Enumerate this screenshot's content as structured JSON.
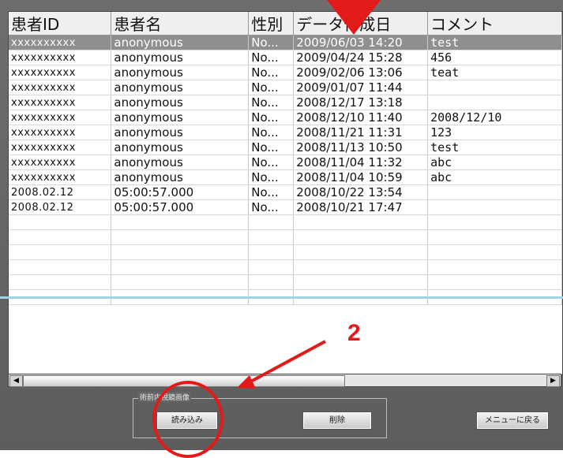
{
  "table": {
    "columns": [
      "患者ID",
      "患者名",
      "性別",
      "データ作成日",
      "コメント"
    ],
    "rows": [
      [
        "xxxxxxxxxx",
        "anonymous",
        "No...",
        "2009/06/03 14:20",
        "test"
      ],
      [
        "xxxxxxxxxx",
        "anonymous",
        "No...",
        "2009/04/24 15:28",
        "456"
      ],
      [
        "xxxxxxxxxx",
        "anonymous",
        "No...",
        "2009/02/06 13:06",
        "teat"
      ],
      [
        "xxxxxxxxxx",
        "anonymous",
        "No...",
        "2009/01/07 11:44",
        ""
      ],
      [
        "xxxxxxxxxx",
        "anonymous",
        "No...",
        "2008/12/17 13:18",
        ""
      ],
      [
        "xxxxxxxxxx",
        "anonymous",
        "No...",
        "2008/12/10 11:40",
        "2008/12/10"
      ],
      [
        "xxxxxxxxxx",
        "anonymous",
        "No...",
        "2008/11/21 11:31",
        "123"
      ],
      [
        "xxxxxxxxxx",
        "anonymous",
        "No...",
        "2008/11/13 10:50",
        "test"
      ],
      [
        "xxxxxxxxxx",
        "anonymous",
        "No...",
        "2008/11/04 11:32",
        "abc"
      ],
      [
        "xxxxxxxxxx",
        "anonymous",
        "No...",
        "2008/11/04 10:59",
        "abc"
      ],
      [
        "2008.02.12",
        "05:00:57.000",
        "No...",
        "2008/10/22 13:54",
        ""
      ],
      [
        "2008.02.12",
        "05:00:57.000",
        "No...",
        "2008/10/21 17:47",
        ""
      ]
    ],
    "selected_row": 0,
    "empty_rows": 6
  },
  "scrollbar": {
    "left_arrow": "◀",
    "right_arrow": "▶"
  },
  "group": {
    "label": "術前内視鏡画像"
  },
  "buttons": {
    "load": "読み込み",
    "delete": "削除",
    "back": "メニューに戻る"
  },
  "annotation": {
    "step_number": "2",
    "color": "#e21a1a"
  },
  "colors": {
    "selected_row_bg": "#8f8f8f",
    "frame_bg": "#666666",
    "guide_line": "#9fd3e0"
  }
}
